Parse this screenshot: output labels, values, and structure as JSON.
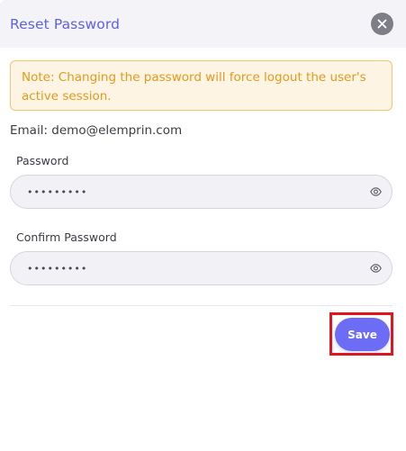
{
  "modal": {
    "title": "Reset Password",
    "note": "Note: Changing the password will force logout the user's active session.",
    "email_line": "Email: demo@elemprin.com"
  },
  "form": {
    "password": {
      "label": "Password",
      "value": "•••••••••"
    },
    "confirm_password": {
      "label": "Confirm Password",
      "value": "•••••••••"
    },
    "save_label": "Save"
  },
  "icons": {
    "close": "close-icon",
    "toggle_visibility": "eye-icon"
  },
  "colors": {
    "title": "#5f61e6",
    "note_text": "#e39a1e",
    "note_bg": "#fef4e3",
    "note_border": "#f2c66f",
    "save_button": "#6c6cf5",
    "highlight_border": "#e3141b"
  }
}
